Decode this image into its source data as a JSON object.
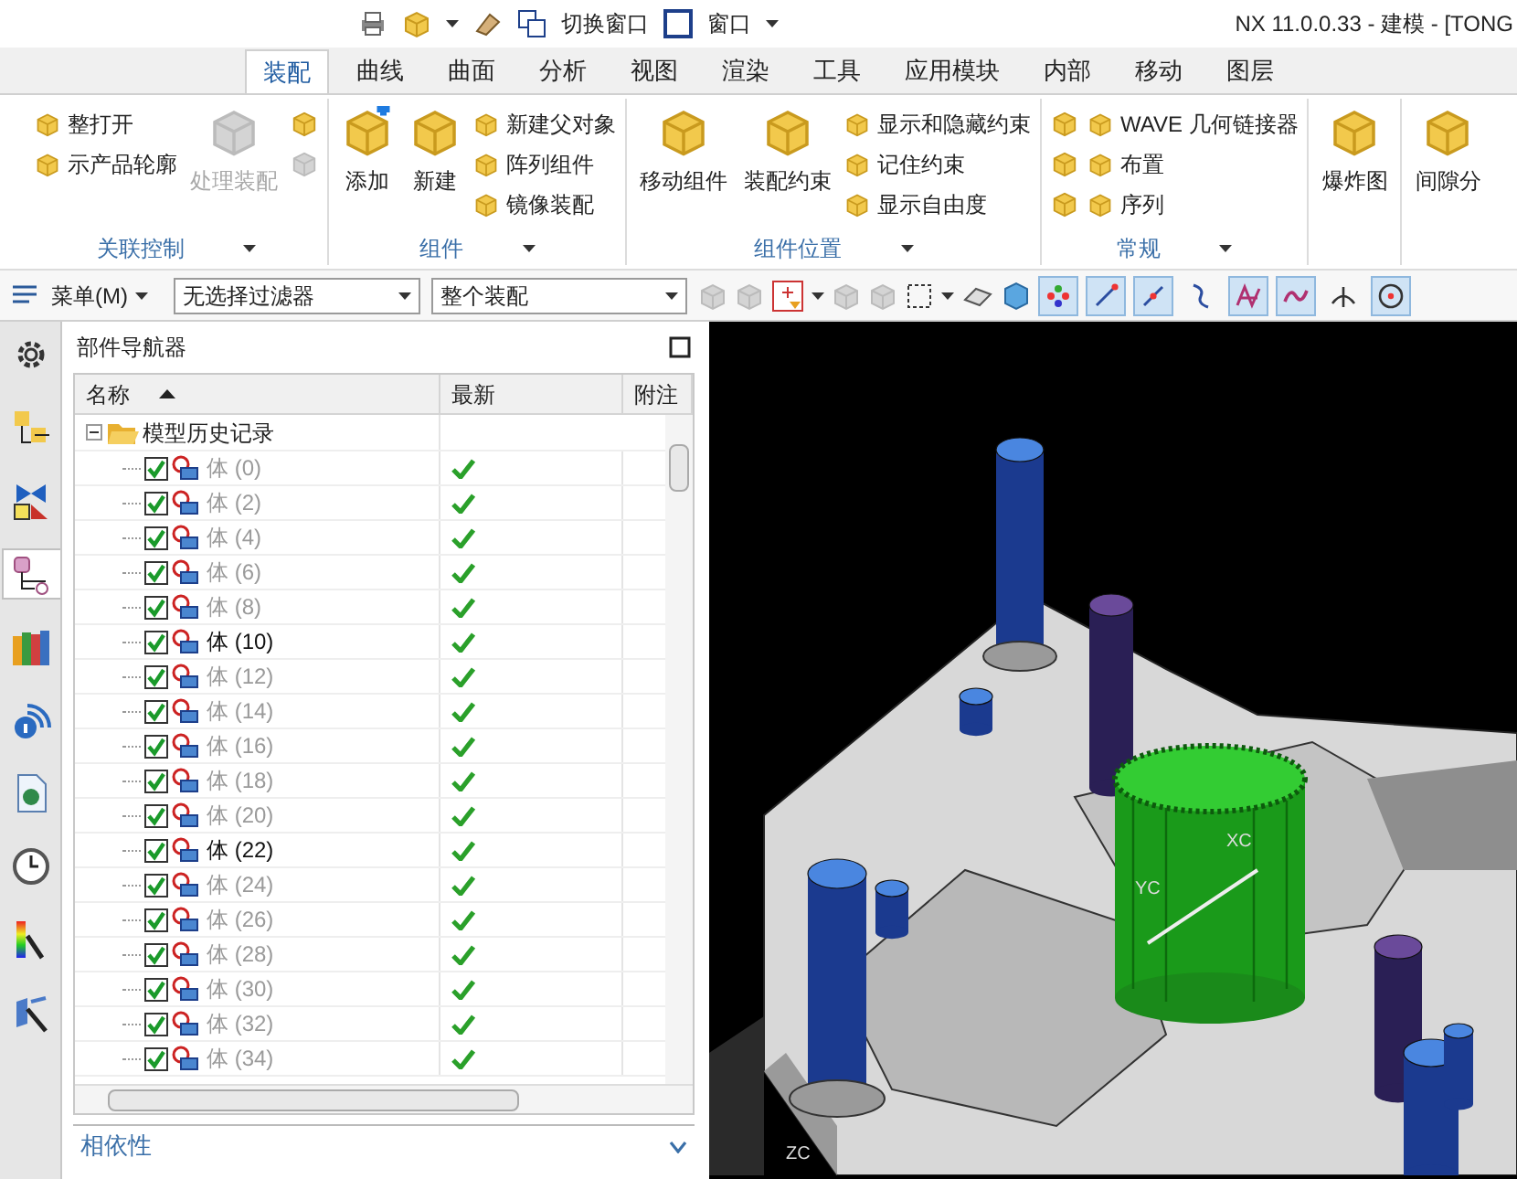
{
  "title_bar": {
    "switch_window": "切换窗口",
    "window_menu": "窗口",
    "title": "NX 11.0.0.33 - 建模 - [TONG"
  },
  "tabs": [
    {
      "label": "装配",
      "selected": true
    },
    {
      "label": "曲线",
      "selected": false
    },
    {
      "label": "曲面",
      "selected": false
    },
    {
      "label": "分析",
      "selected": false
    },
    {
      "label": "视图",
      "selected": false
    },
    {
      "label": "渲染",
      "selected": false
    },
    {
      "label": "工具",
      "selected": false
    },
    {
      "label": "应用模块",
      "selected": false
    },
    {
      "label": "内部",
      "selected": false
    },
    {
      "label": "移动",
      "selected": false
    },
    {
      "label": "图层",
      "selected": false
    }
  ],
  "ribbon": {
    "groups": [
      {
        "label": "关联控制",
        "items": [
          {
            "kind": "small",
            "label": "整打开",
            "disabled": false
          },
          {
            "kind": "small",
            "label": "示产品轮廓",
            "disabled": false
          },
          {
            "kind": "large",
            "label": "处理装配",
            "disabled": true
          },
          {
            "kind": "icon",
            "disabled": false
          },
          {
            "kind": "icon",
            "disabled": true
          }
        ]
      },
      {
        "label": "组件",
        "items": [
          {
            "kind": "large",
            "label": "添加",
            "disabled": false
          },
          {
            "kind": "large",
            "label": "新建",
            "disabled": false
          },
          {
            "kind": "small",
            "label": "新建父对象",
            "disabled": false
          },
          {
            "kind": "small",
            "label": "阵列组件",
            "disabled": false
          },
          {
            "kind": "small",
            "label": "镜像装配",
            "disabled": false
          }
        ]
      },
      {
        "label": "组件位置",
        "items": [
          {
            "kind": "large",
            "label": "移动组件",
            "disabled": false
          },
          {
            "kind": "large",
            "label": "装配约束",
            "disabled": false
          },
          {
            "kind": "small",
            "label": "显示和隐藏约束",
            "disabled": false
          },
          {
            "kind": "small",
            "label": "记住约束",
            "disabled": false
          },
          {
            "kind": "small",
            "label": "显示自由度",
            "disabled": false
          }
        ]
      },
      {
        "label": "常规",
        "items": [
          {
            "kind": "icon",
            "disabled": false
          },
          {
            "kind": "icon",
            "disabled": false
          },
          {
            "kind": "icon",
            "disabled": false
          },
          {
            "kind": "small",
            "label": "WAVE 几何链接器",
            "disabled": false
          },
          {
            "kind": "small",
            "label": "布置",
            "disabled": false
          },
          {
            "kind": "small",
            "label": "序列",
            "disabled": false
          }
        ]
      },
      {
        "items": [
          {
            "kind": "large",
            "label": "爆炸图",
            "disabled": false
          }
        ]
      },
      {
        "items": [
          {
            "kind": "large",
            "label": "间隙分",
            "disabled": false
          }
        ]
      }
    ]
  },
  "toolbar": {
    "menu": "菜单(M)",
    "filter": "无选择过滤器",
    "scope": "整个装配",
    "snap_buttons": [
      {
        "kind": "snap_all",
        "selected": true
      },
      {
        "kind": "endpoint",
        "selected": true
      },
      {
        "kind": "midpoint",
        "selected": true
      },
      {
        "kind": "control",
        "selected": false
      },
      {
        "kind": "intersection",
        "selected": true
      },
      {
        "kind": "on_curve",
        "selected": true
      },
      {
        "kind": "perpendicular",
        "selected": false
      },
      {
        "kind": "center",
        "selected": true
      }
    ]
  },
  "sidebar_tabs": [
    {
      "kind": "settings",
      "selected": false
    },
    {
      "kind": "assembly",
      "selected": false
    },
    {
      "kind": "constraint",
      "selected": false
    },
    {
      "kind": "part",
      "selected": true
    },
    {
      "kind": "library",
      "selected": false
    },
    {
      "kind": "info",
      "selected": false
    },
    {
      "kind": "browser",
      "selected": false
    },
    {
      "kind": "history",
      "selected": false
    },
    {
      "kind": "palette",
      "selected": false
    },
    {
      "kind": "visualization",
      "selected": false
    }
  ],
  "navigator": {
    "title": "部件导航器",
    "columns": [
      {
        "label": "名称",
        "sorted": true
      },
      {
        "label": "最新",
        "sorted": false
      },
      {
        "label": "附注",
        "sorted": false
      }
    ],
    "tree": [
      {
        "label": "模型历史记录",
        "expanded": true,
        "children": [
          {
            "label": "体 (0)",
            "active": false,
            "checked": true,
            "latest": true
          },
          {
            "label": "体 (2)",
            "active": false,
            "checked": true,
            "latest": true
          },
          {
            "label": "体 (4)",
            "active": false,
            "checked": true,
            "latest": true
          },
          {
            "label": "体 (6)",
            "active": false,
            "checked": true,
            "latest": true
          },
          {
            "label": "体 (8)",
            "active": false,
            "checked": true,
            "latest": true
          },
          {
            "label": "体 (10)",
            "active": true,
            "checked": true,
            "latest": true
          },
          {
            "label": "体 (12)",
            "active": false,
            "checked": true,
            "latest": true
          },
          {
            "label": "体 (14)",
            "active": false,
            "checked": true,
            "latest": true
          },
          {
            "label": "体 (16)",
            "active": false,
            "checked": true,
            "latest": true
          },
          {
            "label": "体 (18)",
            "active": false,
            "checked": true,
            "latest": true
          },
          {
            "label": "体 (20)",
            "active": false,
            "checked": true,
            "latest": true
          },
          {
            "label": "体 (22)",
            "active": true,
            "checked": true,
            "latest": true
          },
          {
            "label": "体 (24)",
            "active": false,
            "checked": true,
            "latest": true
          },
          {
            "label": "体 (26)",
            "active": false,
            "checked": true,
            "latest": true
          },
          {
            "label": "体 (28)",
            "active": false,
            "checked": true,
            "latest": true
          },
          {
            "label": "体 (30)",
            "active": false,
            "checked": true,
            "latest": true
          },
          {
            "label": "体 (32)",
            "active": false,
            "checked": true,
            "latest": true
          },
          {
            "label": "体 (34)",
            "active": false,
            "checked": true,
            "latest": true
          }
        ]
      }
    ],
    "dependencies_panel": {
      "label": "相依性",
      "expanded": false
    }
  },
  "viewport": {
    "axis_labels": [
      "XC",
      "YC",
      "ZC"
    ]
  }
}
